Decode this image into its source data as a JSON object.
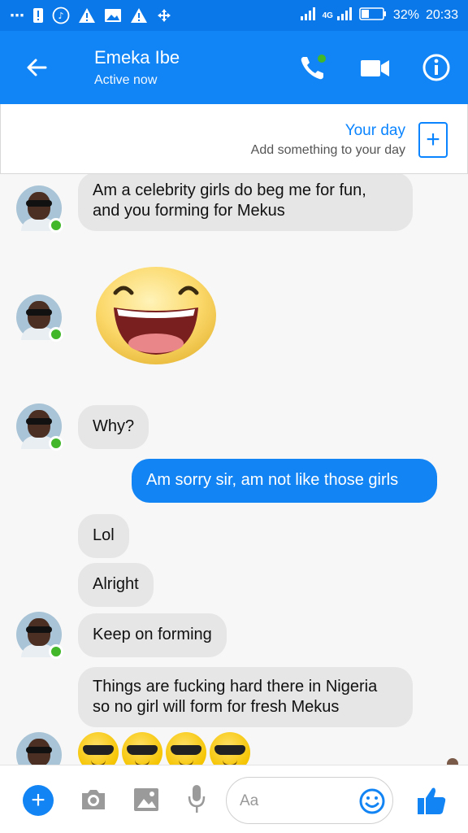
{
  "status_bar": {
    "signal_label": "4G",
    "battery": "32%",
    "time": "20:33"
  },
  "header": {
    "name": "Emeka Ibe",
    "status": "Active now"
  },
  "your_day": {
    "title": "Your day",
    "subtitle": "Add something to your day"
  },
  "messages": [
    {
      "from": "them",
      "text_lines": [
        "Am a celebrity girls do beg me for fun,",
        "and you forming for Mekus"
      ]
    },
    {
      "from": "them",
      "emoji": "laughing-face"
    },
    {
      "from": "them",
      "text": "Why?"
    },
    {
      "from": "me",
      "text": "Am sorry sir,  am not like those girls"
    },
    {
      "from": "them",
      "text": "Lol"
    },
    {
      "from": "them",
      "text": "Alright"
    },
    {
      "from": "them",
      "text": "Keep on forming"
    },
    {
      "from": "them",
      "text_lines": [
        "Things are fucking hard there in Nigeria",
        "so no girl will form for fresh Mekus"
      ]
    },
    {
      "from": "them",
      "emoji": "sunglasses-face",
      "count": 4
    }
  ],
  "composer": {
    "placeholder": "Aa"
  },
  "colors": {
    "accent": "#1284f4",
    "online": "#42b72a",
    "bubble_them": "#e6e6e6"
  }
}
